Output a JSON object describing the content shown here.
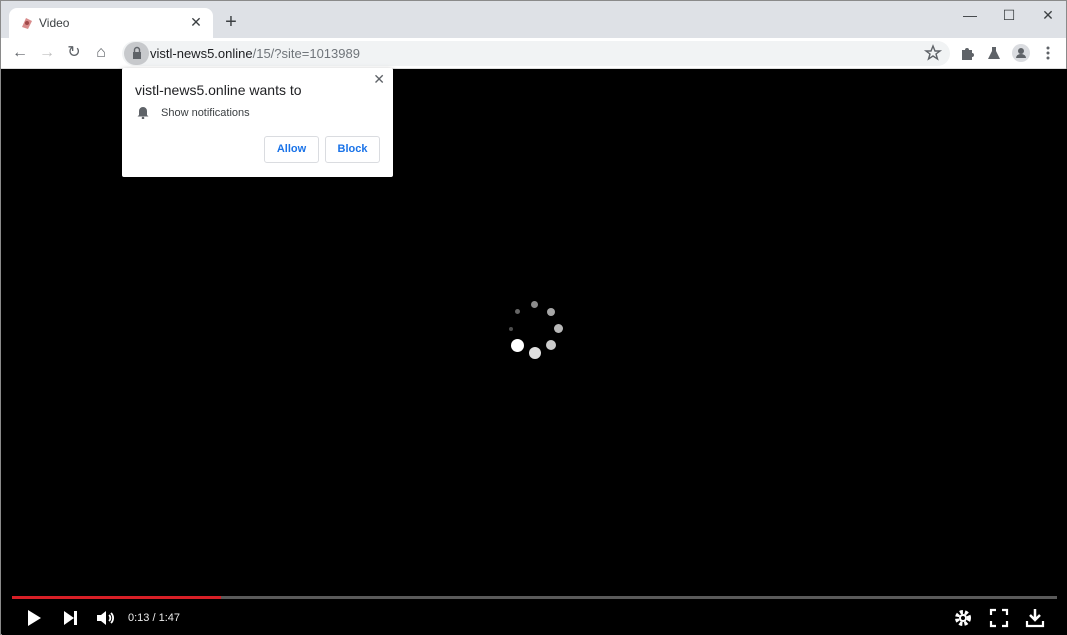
{
  "browser": {
    "tab": {
      "title": "Video",
      "close_icon": "close-icon",
      "favicon": "site-favicon"
    },
    "new_tab_icon": "plus-icon",
    "window_controls": [
      "minimize-icon",
      "maximize-icon",
      "close-icon"
    ],
    "nav": [
      "back-icon",
      "forward-icon",
      "reload-icon",
      "home-icon"
    ],
    "url": {
      "host": "vistl-news5.online",
      "path": "/15/?site=1013989"
    },
    "toolbar_icons": [
      "star-icon",
      "extensions-icon",
      "labs-icon",
      "profile-icon",
      "menu-icon"
    ]
  },
  "permission_popup": {
    "title": "vistl-news5.online wants to",
    "permission": "Show notifications",
    "allow_label": "Allow",
    "block_label": "Block"
  },
  "player": {
    "time_display": "0:13 / 1:47",
    "progress_fraction": 0.2,
    "progress_color": "#d81f26",
    "controls": [
      "play-icon",
      "next-icon",
      "volume-icon",
      "settings-icon",
      "fullscreen-icon",
      "download-icon"
    ]
  }
}
